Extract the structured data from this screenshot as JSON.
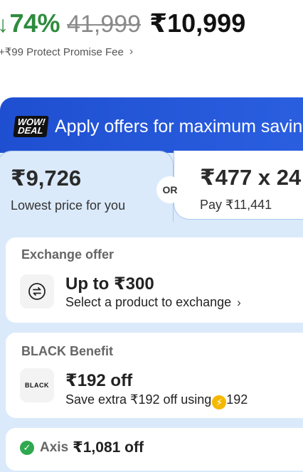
{
  "price": {
    "discount_arrow": "↓",
    "discount": "74%",
    "mrp": "41,999",
    "final": "₹10,999"
  },
  "protect_fee": {
    "label": "+₹99 Protect Promise Fee",
    "chevron": "›"
  },
  "offers": {
    "badge_line1": "WOW!",
    "badge_line2": "DEAL",
    "header": "Apply offers for maximum savings",
    "lowest_price": {
      "amount": "₹9,726",
      "label": "Lowest price for you"
    },
    "or_label": "OR",
    "emi": {
      "amount": "₹477 x 24",
      "label": "Pay ₹11,441"
    },
    "exchange": {
      "title": "Exchange offer",
      "icon": "exchange-arrows-icon",
      "amount": "Up to ₹300",
      "action": "Select a product to exchange",
      "chevron": "›"
    },
    "black": {
      "title": "BLACK Benefit",
      "logo_text": "BLACK",
      "amount": "₹192 off",
      "desc_prefix": "Save extra ₹192 off using",
      "coin_value": "192",
      "coin_icon": "⚡"
    },
    "axis": {
      "check_icon": "✓",
      "bank": "Axis",
      "amount": "₹1,081 off"
    }
  }
}
